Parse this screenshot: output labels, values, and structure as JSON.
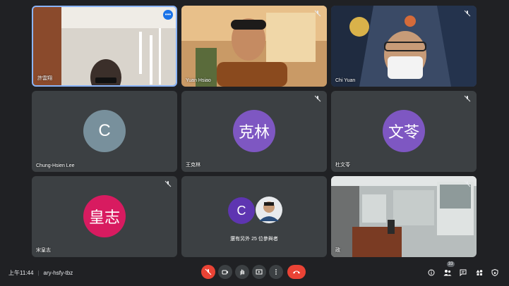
{
  "tiles": [
    {
      "name": "許雲翔",
      "type": "video"
    },
    {
      "name": "Yuan Hsiao",
      "type": "video"
    },
    {
      "name": "Chi Yuan",
      "type": "video"
    },
    {
      "name": "Chung-Hsien Lee",
      "initial": "C",
      "color": "#78909c"
    },
    {
      "name": "王克林",
      "initial": "克林",
      "color": "#7e57c2"
    },
    {
      "name": "杜文苓",
      "initial": "文苓",
      "color": "#7e57c2"
    },
    {
      "name": "宋皇志",
      "initial": "皇志",
      "color": "#d81b60"
    },
    {
      "group_initial": "C",
      "group_color": "#5e35b1",
      "label": "還有另外 25 位參與者"
    },
    {
      "name": "政",
      "type": "video"
    }
  ],
  "bottom": {
    "time": "上午11:44",
    "meeting_code": "ary-hsfy-tbz",
    "participants_count": "33"
  },
  "colors": {
    "background": "#202124",
    "tile": "#3c4043",
    "accent": "#1a73e8",
    "danger": "#ea4335"
  }
}
